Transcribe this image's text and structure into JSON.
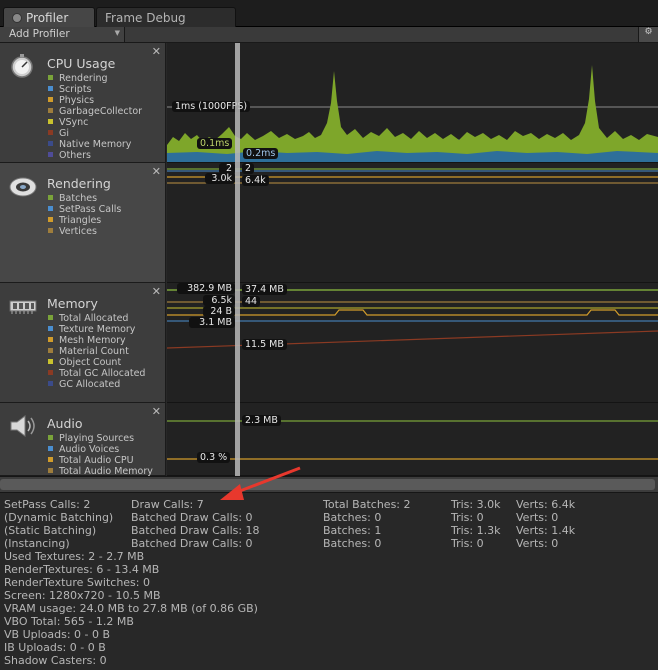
{
  "tabs": [
    {
      "label": "Profiler",
      "icon": "profiler-icon"
    },
    {
      "label": "Frame Debug"
    }
  ],
  "toolbar": {
    "add_profiler_label": "Add Profiler",
    "settings_icon": "settings-icon"
  },
  "modules": {
    "cpu": {
      "title": "CPU Usage",
      "legend": [
        {
          "label": "Rendering",
          "color": "#7aa33a"
        },
        {
          "label": "Scripts",
          "color": "#4a8ecf"
        },
        {
          "label": "Physics",
          "color": "#d19c2b"
        },
        {
          "label": "GarbageCollector",
          "color": "#9e7d3c"
        },
        {
          "label": "VSync",
          "color": "#c9c22e"
        },
        {
          "label": "Gi",
          "color": "#8b3a23"
        },
        {
          "label": "Native Memory",
          "color": "#3b4b8a"
        },
        {
          "label": "Others",
          "color": "#4f4c98"
        }
      ],
      "labels": {
        "fps": "1ms (1000FPS)",
        "left_value": "0.1ms",
        "right_value": "0.2ms"
      }
    },
    "rendering": {
      "title": "Rendering",
      "legend": [
        {
          "label": "Batches",
          "color": "#7aa33a"
        },
        {
          "label": "SetPass Calls",
          "color": "#4a8ecf"
        },
        {
          "label": "Triangles",
          "color": "#d19c2b"
        },
        {
          "label": "Vertices",
          "color": "#9e7d3c"
        }
      ],
      "labels": {
        "batches_left": "2",
        "batches_right": "2",
        "tris_left": "3.0k",
        "tris_right": "6.4k"
      }
    },
    "memory": {
      "title": "Memory",
      "legend": [
        {
          "label": "Total Allocated",
          "color": "#7aa33a"
        },
        {
          "label": "Texture Memory",
          "color": "#4a8ecf"
        },
        {
          "label": "Mesh Memory",
          "color": "#d19c2b"
        },
        {
          "label": "Material Count",
          "color": "#9e7d3c"
        },
        {
          "label": "Object Count",
          "color": "#c9c22e"
        },
        {
          "label": "Total GC Allocated",
          "color": "#8b3a23"
        },
        {
          "label": "GC Allocated",
          "color": "#3b4b8a"
        }
      ],
      "labels": {
        "total_left": "382.9 MB",
        "total_right": "37.4 MB",
        "mat_left": "6.5k",
        "mat_right": "44",
        "gc_left": "24 B",
        "tex_left": "3.1 MB",
        "gc_total_right": "11.5 MB"
      }
    },
    "audio": {
      "title": "Audio",
      "legend": [
        {
          "label": "Playing Sources",
          "color": "#7aa33a"
        },
        {
          "label": "Audio Voices",
          "color": "#4a8ecf"
        },
        {
          "label": "Total Audio CPU",
          "color": "#d19c2b"
        },
        {
          "label": "Total Audio Memory",
          "color": "#9e7d3c"
        }
      ],
      "labels": {
        "memory_right": "2.3 MB",
        "cpu_left": "0.3 %"
      }
    }
  },
  "stats": {
    "col1": [
      "SetPass Calls: 2",
      "(Dynamic Batching)",
      "(Static Batching)",
      "(Instancing)",
      "Used Textures: 2 - 2.7 MB",
      "RenderTextures: 6 - 13.4 MB",
      "RenderTexture Switches: 0",
      "Screen: 1280x720 - 10.5 MB",
      "VRAM usage: 24.0 MB to 27.8 MB (of 0.86 GB)",
      "VBO Total: 565 - 1.2 MB",
      "VB Uploads: 0 - 0 B",
      "IB Uploads: 0 - 0 B",
      "Shadow Casters: 0"
    ],
    "col2": [
      "Draw Calls: 7",
      "Batched Draw Calls: 0",
      "Batched Draw Calls: 18",
      "Batched Draw Calls: 0"
    ],
    "col3": [
      "Total Batches: 2",
      "Batches: 0",
      "Batches: 1",
      "Batches: 0"
    ],
    "col4": [
      "Tris: 3.0k",
      "Tris: 0",
      "Tris: 1.3k",
      "Tris: 0"
    ],
    "col5": [
      "Verts: 6.4k",
      "Verts: 0",
      "Verts: 1.4k",
      "Verts: 0"
    ]
  },
  "annotation": {
    "arrow_color": "#e8382d"
  }
}
